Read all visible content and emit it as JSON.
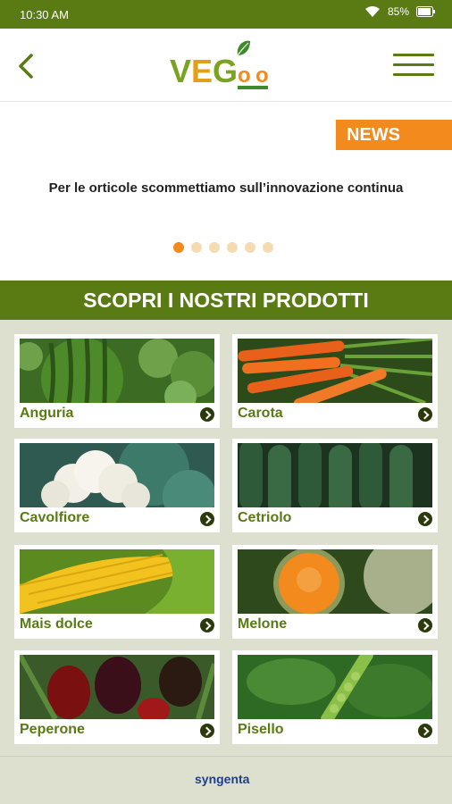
{
  "status": {
    "time": "10:30 AM",
    "battery": "85%"
  },
  "header": {
    "logo_text": "VEGOO"
  },
  "news": {
    "badge": "NEWS",
    "text": "Per le orticole scommettiamo sull’innovazione continua",
    "dots": 6,
    "active_dot": 0
  },
  "section": {
    "title": "SCOPRI I NOSTRI PRODOTTI"
  },
  "products": [
    {
      "name": "Anguria"
    },
    {
      "name": "Carota"
    },
    {
      "name": "Cavolfiore"
    },
    {
      "name": "Cetriolo"
    },
    {
      "name": "Mais dolce"
    },
    {
      "name": "Melone"
    },
    {
      "name": "Peperone"
    },
    {
      "name": "Pisello"
    }
  ],
  "footer": {
    "brand": "syngenta"
  },
  "colors": {
    "brand_green": "#5a7a14",
    "accent_orange": "#f28a1e",
    "panel_bg": "#dde0ce"
  }
}
